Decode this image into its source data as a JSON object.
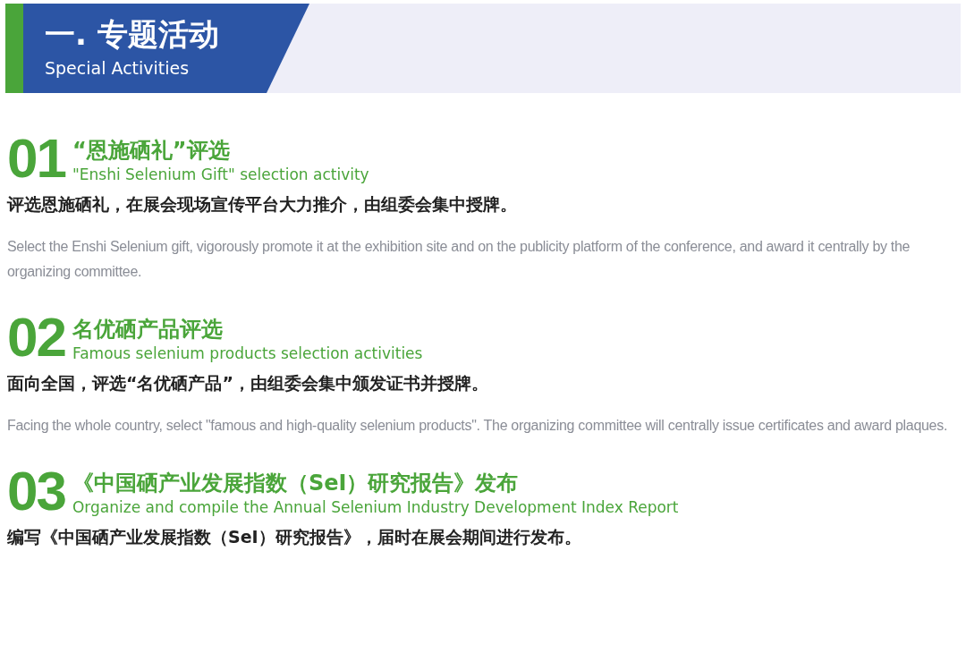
{
  "header": {
    "title": "一. 专题活动",
    "subtitle": "Special Activities"
  },
  "activities": [
    {
      "number": "01",
      "title": "“恩施硒礼”评选",
      "subtitle": "\"Enshi Selenium Gift\" selection activity",
      "description_zh": "评选恩施硒礼，在展会现场宣传平台大力推介，由组委会集中授牌。",
      "description_en": "Select the Enshi Selenium gift, vigorously promote it at the exhibition site and on the publicity platform of the conference, and award it centrally by the organizing committee."
    },
    {
      "number": "02",
      "title": "名优硒产品评选",
      "subtitle": "Famous selenium products selection activities",
      "description_zh": "面向全国，评选“名优硒产品”，由组委会集中颁发证书并授牌。",
      "description_en": "Facing the whole country, select \"famous and high-quality selenium products\". The organizing committee will centrally issue certificates and award plaques."
    },
    {
      "number": "03",
      "title": "《中国硒产业发展指数（SeI）研究报告》发布",
      "subtitle": "Organize and compile the Annual Selenium Industry Development Index Report",
      "description_zh": "编写《中国硒产业发展指数（SeI）研究报告》，届时在展会期间进行发布。"
    }
  ]
}
